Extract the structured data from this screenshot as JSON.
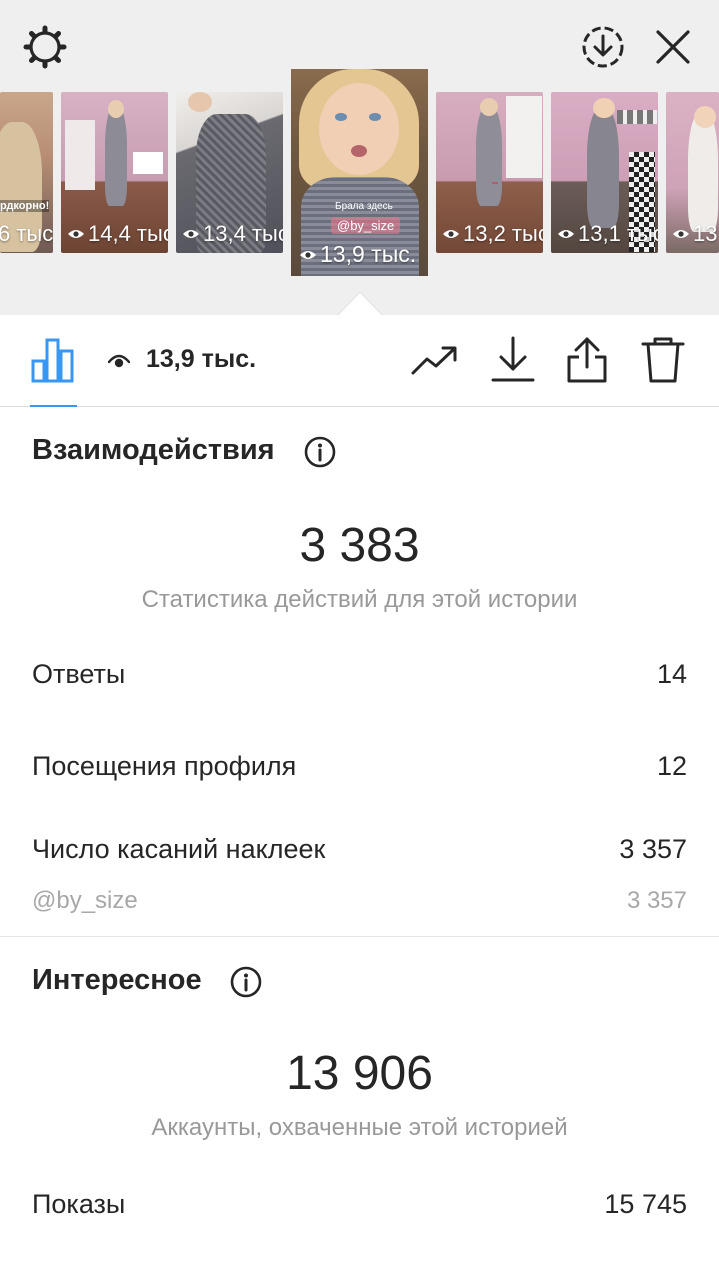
{
  "stories": [
    {
      "views": "6 тыс",
      "sticker": "рдкорно!"
    },
    {
      "views": "14,4 тыс"
    },
    {
      "views": "13,4 тыс"
    },
    {
      "views": "13,9 тыс.",
      "sticker": "Брала здесь",
      "mention": "@by_size",
      "active": true
    },
    {
      "views": "13,2 тыс"
    },
    {
      "views": "13,1 тыс"
    },
    {
      "views": "13"
    }
  ],
  "toolbar": {
    "views": "13,9 тыс."
  },
  "interactions": {
    "title": "Взаимодействия",
    "total": "3 383",
    "caption": "Статистика действий для этой истории",
    "rows": [
      {
        "label": "Ответы",
        "value": "14"
      },
      {
        "label": "Посещения профиля",
        "value": "12"
      },
      {
        "label": "Число касаний наклеек",
        "value": "3 357"
      }
    ],
    "sub_row": {
      "label": "@by_size",
      "value": "3 357"
    }
  },
  "discovery": {
    "title": "Интересное",
    "total": "13 906",
    "caption": "Аккаунты, охваченные этой историей",
    "rows": [
      {
        "label": "Показы",
        "value": "15 745"
      }
    ]
  },
  "colors": {
    "accent": "#3897f0",
    "text": "#262626",
    "muted": "#999999"
  }
}
